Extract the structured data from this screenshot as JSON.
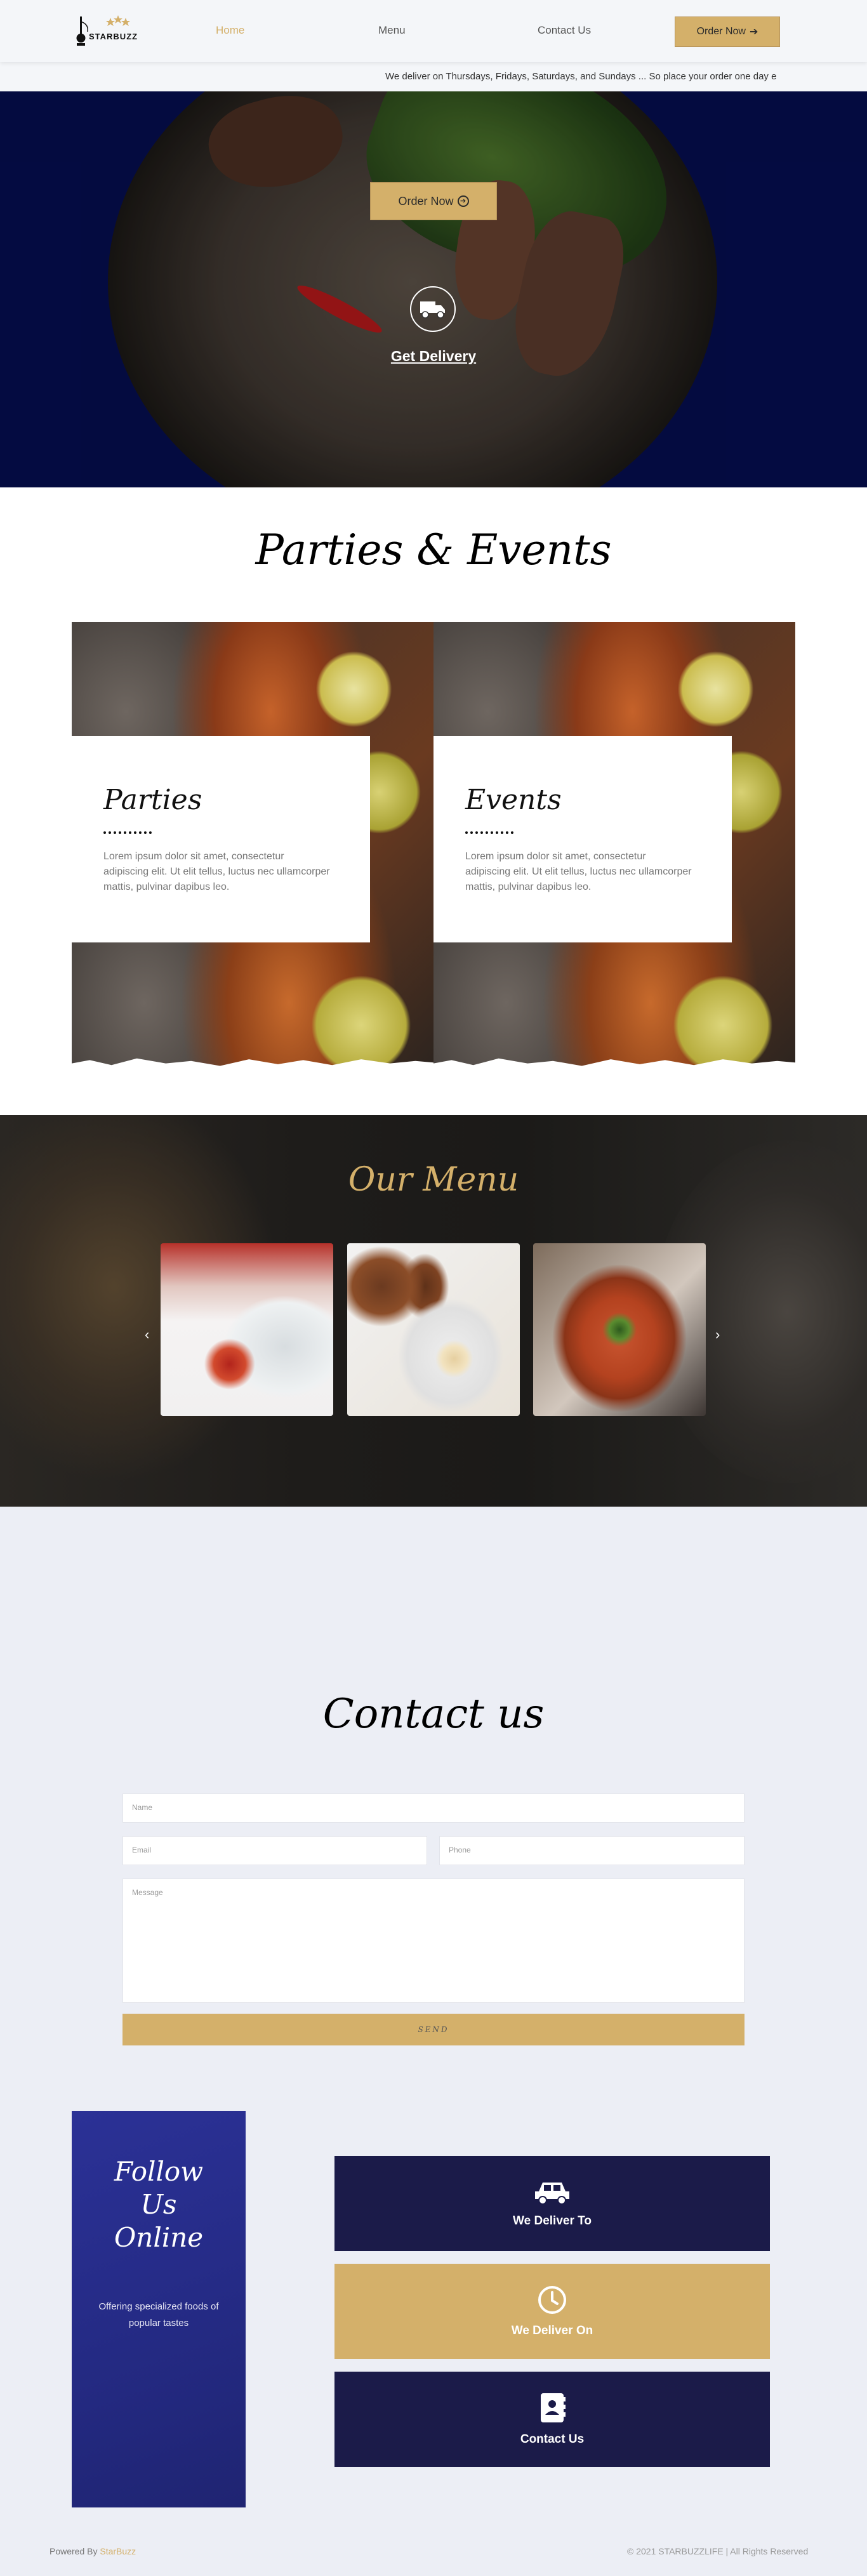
{
  "header": {
    "logo_text": "STARBUZZ",
    "nav": [
      {
        "label": "Home",
        "active": true
      },
      {
        "label": "Menu",
        "active": false
      },
      {
        "label": "Contact Us",
        "active": false
      }
    ],
    "order_button": "Order Now"
  },
  "ticker": {
    "text": "We deliver on Thursdays, Fridays, Saturdays, and Sundays ... So place your order one day e"
  },
  "hero": {
    "order_button": "Order Now",
    "delivery_link": "Get Delivery",
    "truck_icon": "truck-icon"
  },
  "parties": {
    "title": "Parties & Events",
    "cards": [
      {
        "title": "Parties",
        "text": "Lorem ipsum dolor sit amet, consectetur adipiscing elit. Ut elit tellus, luctus nec ullamcorper mattis, pulvinar dapibus leo."
      },
      {
        "title": "Events",
        "text": "Lorem ipsum dolor sit amet, consectetur adipiscing elit. Ut elit tellus, luctus nec ullamcorper mattis, pulvinar dapibus leo."
      }
    ]
  },
  "menu": {
    "title": "Our Menu",
    "prev_icon": "chevron-left-icon",
    "next_icon": "chevron-right-icon"
  },
  "contact": {
    "title": "Contact us",
    "name_placeholder": "Name",
    "email_placeholder": "Email",
    "phone_placeholder": "Phone",
    "message_placeholder": "Message",
    "send_button": "SEND"
  },
  "follow": {
    "title": "Follow Us Online",
    "subtitle": "Offering specialized foods of popular tastes"
  },
  "info_boxes": [
    {
      "label": "We Deliver To",
      "icon": "car-icon",
      "style": "dark"
    },
    {
      "label": "We Deliver On",
      "icon": "clock-icon",
      "style": "gold"
    },
    {
      "label": "Contact Us",
      "icon": "contact-book-icon",
      "style": "dark"
    }
  ],
  "footer": {
    "powered_prefix": "Powered By",
    "powered_brand": "StarBuzz",
    "copyright": "© 2021 STARBUZZLIFE | All Rights Reserved"
  },
  "colors": {
    "gold": "#d4b06a",
    "navy": "#1b1b49",
    "hero_blue": "#050e4f",
    "follow_blue": "#252b86",
    "page_bg": "#eceef5"
  }
}
